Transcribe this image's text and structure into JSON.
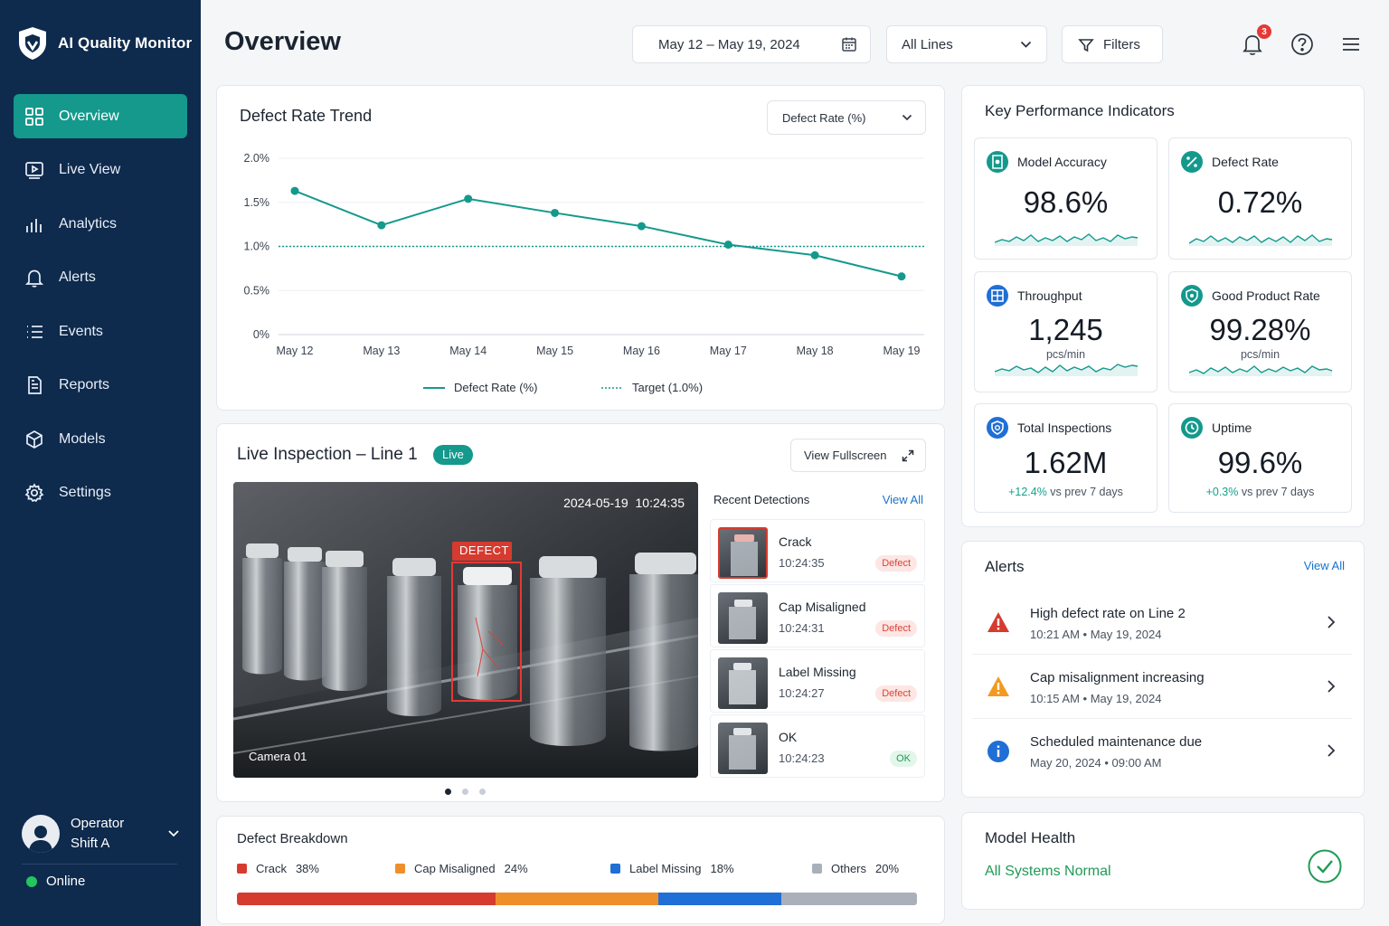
{
  "app": {
    "name": "AI Quality Monitor"
  },
  "nav": [
    {
      "label": "Overview",
      "icon": "grid-icon",
      "active": true
    },
    {
      "label": "Live View",
      "icon": "play-screen-icon"
    },
    {
      "label": "Analytics",
      "icon": "bar-chart-icon"
    },
    {
      "label": "Alerts",
      "icon": "bell-icon"
    },
    {
      "label": "Events",
      "icon": "list-icon"
    },
    {
      "label": "Reports",
      "icon": "document-icon"
    },
    {
      "label": "Models",
      "icon": "cube-icon"
    },
    {
      "label": "Settings",
      "icon": "gear-icon"
    }
  ],
  "operator": {
    "name": "Operator",
    "shift": "Shift A",
    "status": "Online"
  },
  "header": {
    "title": "Overview",
    "date_range": "May 12 – May 19, 2024",
    "line_select": "All Lines",
    "filters_label": "Filters",
    "notification_count": "3"
  },
  "trend": {
    "title": "Defect Rate Trend",
    "metric_select": "Defect Rate (%)",
    "legend_series": "Defect Rate (%)",
    "legend_target": "Target (1.0%)"
  },
  "chart_data": {
    "type": "line",
    "x": [
      "May 12",
      "May 13",
      "May 14",
      "May 15",
      "May 16",
      "May 17",
      "May 18",
      "May 19"
    ],
    "series": [
      {
        "name": "Defect Rate (%)",
        "values": [
          1.63,
          1.24,
          1.54,
          1.38,
          1.23,
          1.02,
          0.9,
          0.66
        ]
      },
      {
        "name": "Target (1.0%)",
        "values": [
          1.0,
          1.0,
          1.0,
          1.0,
          1.0,
          1.0,
          1.0,
          1.0
        ]
      }
    ],
    "y_ticks": [
      "2.0%",
      "1.5%",
      "1.0%",
      "0.5%",
      "0%"
    ],
    "ylim": [
      0,
      2.0
    ],
    "grid": true,
    "legend_position": "bottom",
    "colors": {
      "series": "#14998c",
      "target": "#14998c"
    }
  },
  "live": {
    "title": "Live Inspection – Line 1",
    "badge": "Live",
    "fullscreen_label": "View Fullscreen",
    "timestamp": "2024-05-19  10:24:35",
    "camera": "Camera 01",
    "defect_label": "DEFECT",
    "recent_title": "Recent Detections",
    "view_all": "View All",
    "detections": [
      {
        "name": "Crack",
        "time": "10:24:35",
        "status": "Defect"
      },
      {
        "name": "Cap Misaligned",
        "time": "10:24:31",
        "status": "Defect"
      },
      {
        "name": "Label Missing",
        "time": "10:24:27",
        "status": "Defect"
      },
      {
        "name": "OK",
        "time": "10:24:23",
        "status": "OK"
      }
    ]
  },
  "breakdown": {
    "title": "Defect Breakdown",
    "items": [
      {
        "label": "Crack",
        "pct": "38%",
        "value": 38,
        "color": "#d63b30"
      },
      {
        "label": "Cap Misaligned",
        "pct": "24%",
        "value": 24,
        "color": "#ef8f2a"
      },
      {
        "label": "Label Missing",
        "pct": "18%",
        "value": 18,
        "color": "#1f6fd6"
      },
      {
        "label": "Others",
        "pct": "20%",
        "value": 20,
        "color": "#a9b0ba"
      }
    ]
  },
  "kpi": {
    "title": "Key Performance Indicators",
    "cards": [
      {
        "label": "Model Accuracy",
        "value": "98.6%",
        "sub": "",
        "delta": "",
        "delta_rest": "",
        "icon": "target-icon",
        "color": "#14998c"
      },
      {
        "label": "Defect Rate",
        "value": "0.72%",
        "sub": "",
        "delta": "",
        "delta_rest": "",
        "icon": "percent-icon",
        "color": "#14998c"
      },
      {
        "label": "Throughput",
        "value": "1,245",
        "sub": "pcs/min",
        "delta": "",
        "delta_rest": "",
        "icon": "grid-box-icon",
        "color": "#1f6fd6"
      },
      {
        "label": "Good Product Rate",
        "value": "99.28%",
        "sub": "pcs/min",
        "delta": "",
        "delta_rest": "",
        "icon": "shield-check-icon",
        "color": "#14998c"
      },
      {
        "label": "Total Inspections",
        "value": "1.62M",
        "sub": "",
        "delta": "+12.4%",
        "delta_rest": " vs prev 7 days",
        "icon": "scan-icon",
        "color": "#1f6fd6"
      },
      {
        "label": "Uptime",
        "value": "99.6%",
        "sub": "",
        "delta": "+0.3%",
        "delta_rest": " vs prev 7 days",
        "icon": "clock-icon",
        "color": "#14998c"
      }
    ]
  },
  "alerts": {
    "title": "Alerts",
    "view_all": "View All",
    "items": [
      {
        "title": "High defect rate on Line 2",
        "meta": "10:21 AM  •  May 19, 2024",
        "level": "error",
        "color": "#d63b30"
      },
      {
        "title": "Cap misalignment increasing",
        "meta": "10:15 AM  •  May 19, 2024",
        "level": "warning",
        "color": "#f29a1f"
      },
      {
        "title": "Scheduled maintenance due",
        "meta": "May 20, 2024  •  09:00 AM",
        "level": "info",
        "color": "#1f6fd6"
      }
    ]
  },
  "health": {
    "title": "Model Health",
    "status": "All Systems Normal",
    "color": "#1f9b55"
  }
}
